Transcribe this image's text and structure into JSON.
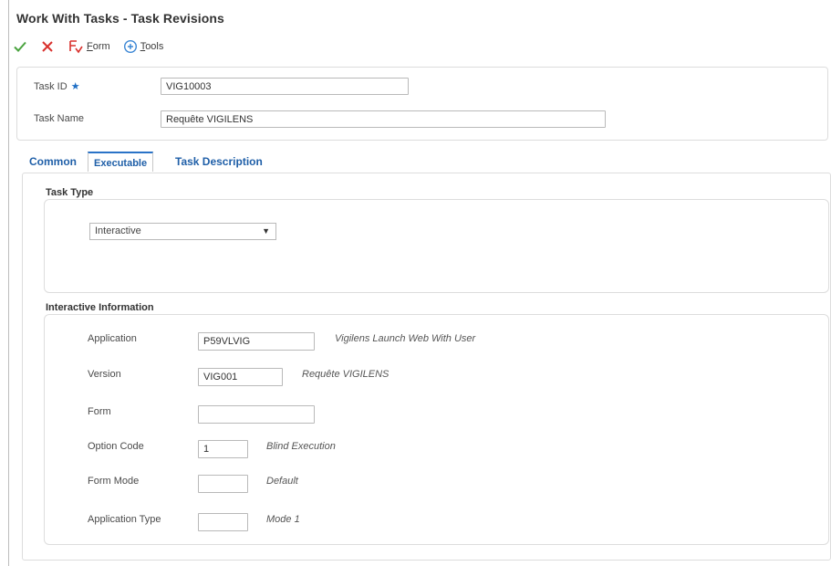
{
  "window": {
    "title": "Work With Tasks - Task Revisions"
  },
  "toolbar": {
    "form_label_first": "F",
    "form_label_rest": "orm",
    "tools_label_first": "T",
    "tools_label_rest": "ools"
  },
  "header": {
    "task_id_label": "Task ID",
    "required_marker": "★",
    "task_id_value": "VIG10003",
    "task_name_label": "Task Name",
    "task_name_value": "Requête VIGILENS"
  },
  "tabs": [
    {
      "label": "Common"
    },
    {
      "label": "Executable"
    },
    {
      "label": "Task Description"
    }
  ],
  "task_type": {
    "section_title": "Task Type",
    "selected_value": "Interactive",
    "arrow": "▼"
  },
  "interactive_info": {
    "section_title": "Interactive Information",
    "application": {
      "label": "Application",
      "value": "P59VLVIG",
      "description": "Vigilens Launch Web With User"
    },
    "version": {
      "label": "Version",
      "value": "VIG001",
      "description": "Requête VIGILENS"
    },
    "form": {
      "label": "Form",
      "value": ""
    },
    "option_code": {
      "label": "Option Code",
      "value": "1",
      "description": "Blind Execution"
    },
    "form_mode": {
      "label": "Form Mode",
      "value": "",
      "description": "Default"
    },
    "application_type": {
      "label": "Application Type",
      "value": "",
      "description": "Mode 1"
    }
  },
  "colors": {
    "accent": "#1f5fa8",
    "ok_green": "#4aa33f",
    "cancel_red": "#d9302c",
    "tools_blue": "#3a86d4"
  }
}
